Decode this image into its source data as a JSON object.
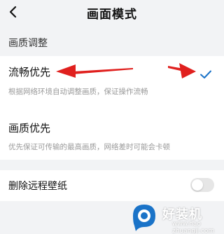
{
  "header": {
    "back_icon": "chevron-left-icon",
    "title": "画面模式"
  },
  "section": {
    "title": "画质调整"
  },
  "options": [
    {
      "label": "流畅优先",
      "description": "根据网络环境自动调整画质，保证操作流畅",
      "selected": true
    },
    {
      "label": "画质优先",
      "description": "优先保证可传输的最高画质，网络差时可能会卡顿",
      "selected": false
    }
  ],
  "settings": {
    "remove_wallpaper_label": "删除远程壁纸",
    "remove_wallpaper_enabled": false
  },
  "watermark": {
    "brand": "好装机",
    "sub": "www.hao zhuangji.com"
  },
  "colors": {
    "accent": "#1a73c8",
    "annotation_arrow": "#e0201e",
    "background": "#f2f3f5",
    "card": "#ffffff",
    "toggle_off": "#e6e6e6"
  }
}
